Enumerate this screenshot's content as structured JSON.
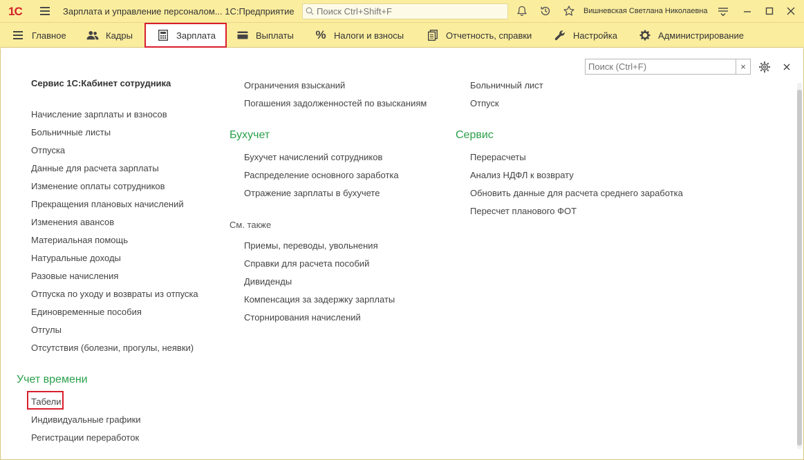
{
  "titlebar": {
    "logo": "1С",
    "app_title": "Зарплата и управление персоналом... 1С:Предприятие",
    "search_placeholder": "Поиск Ctrl+Shift+F",
    "user_name": "Вишневская Светлана Николаевна"
  },
  "menu": [
    {
      "label": "Главное",
      "icon": "hamburger-icon"
    },
    {
      "label": "Кадры",
      "icon": "people-icon"
    },
    {
      "label": "Зарплата",
      "icon": "calculator-icon",
      "active": true
    },
    {
      "label": "Выплаты",
      "icon": "wallet-icon"
    },
    {
      "label": "Налоги и взносы",
      "icon": "percent-icon"
    },
    {
      "label": "Отчетность, справки",
      "icon": "documents-icon"
    },
    {
      "label": "Настройка",
      "icon": "wrench-icon"
    },
    {
      "label": "Администрирование",
      "icon": "gear-icon"
    }
  ],
  "panel": {
    "search_placeholder": "Поиск (Ctrl+F)",
    "clear": "×",
    "close": "×"
  },
  "col1": {
    "top_title": "Сервис 1С:Кабинет сотрудника",
    "links": [
      "Начисление зарплаты и взносов",
      "Больничные листы",
      "Отпуска",
      "Данные для расчета зарплаты",
      "Изменение оплаты сотрудников",
      "Прекращения плановых начислений",
      "Изменения авансов",
      "Материальная помощь",
      "Натуральные доходы",
      "Разовые начисления",
      "Отпуска по уходу и возвраты из отпуска",
      "Единовременные пособия",
      "Отгулы",
      "Отсутствия (болезни, прогулы, неявки)"
    ],
    "time_group": {
      "title": "Учет времени",
      "links": [
        "Табели",
        "Индивидуальные графики",
        "Регистрации переработок"
      ]
    }
  },
  "col2": {
    "top_links": [
      "Ограничения взысканий",
      "Погашения задолженностей по взысканиям"
    ],
    "buhuchet": {
      "title": "Бухучет",
      "links": [
        "Бухучет начислений сотрудников",
        "Распределение основного заработка",
        "Отражение зарплаты в бухучете"
      ]
    },
    "see_also": {
      "title": "См. также",
      "links": [
        "Приемы, переводы, увольнения",
        "Справки для расчета пособий",
        "Дивиденды",
        "Компенсация за задержку зарплаты",
        "Сторнирования начислений"
      ]
    }
  },
  "col3": {
    "top_links": [
      "Больничный лист",
      "Отпуск"
    ],
    "service": {
      "title": "Сервис",
      "links": [
        "Перерасчеты",
        "Анализ НДФЛ к возврату",
        "Обновить данные для расчета среднего заработка",
        "Пересчет планового ФОТ"
      ]
    }
  },
  "colors": {
    "yellow": "#fbed9e",
    "green_title": "#2aa04a",
    "highlight_red": "#d81e2c"
  }
}
